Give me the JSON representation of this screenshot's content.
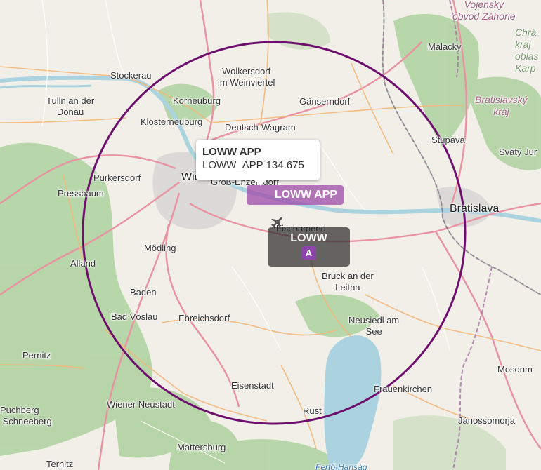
{
  "map": {
    "places": [
      {
        "id": "vojensky",
        "text": "Vojenský\nobvod Záhorie",
        "kind": "region"
      },
      {
        "id": "malacky",
        "text": "Malacky",
        "kind": "town"
      },
      {
        "id": "stockerau",
        "text": "Stockerau",
        "kind": "town"
      },
      {
        "id": "wolkersdorf",
        "text": "Wolkersdorf\nim Weinviertel",
        "kind": "town"
      },
      {
        "id": "tulln",
        "text": "Tulln an der\nDonau",
        "kind": "town"
      },
      {
        "id": "korneuburg",
        "text": "Korneuburg",
        "kind": "town"
      },
      {
        "id": "gaenserndorf",
        "text": "Gänserndorf",
        "kind": "town"
      },
      {
        "id": "klosterneuburg",
        "text": "Klosterneuburg",
        "kind": "town"
      },
      {
        "id": "deutsch_wagram",
        "text": "Deutsch-Wagram",
        "kind": "town"
      },
      {
        "id": "stupava",
        "text": "Stupava",
        "kind": "town"
      },
      {
        "id": "svaty_jur",
        "text": "Svätý Jur",
        "kind": "town"
      },
      {
        "id": "purkersdorf",
        "text": "Purkersdorf",
        "kind": "town"
      },
      {
        "id": "wien",
        "text": "Wien",
        "kind": "city"
      },
      {
        "id": "gross_enzersdorf",
        "text": "Groß-Enzersdorf",
        "kind": "town"
      },
      {
        "id": "pressbaum",
        "text": "Pressbaum",
        "kind": "town"
      },
      {
        "id": "bratislava",
        "text": "Bratislava",
        "kind": "city"
      },
      {
        "id": "fischamend",
        "text": "Fischamend",
        "kind": "town"
      },
      {
        "id": "moedling",
        "text": "Mödling",
        "kind": "town"
      },
      {
        "id": "alland",
        "text": "Alland",
        "kind": "town"
      },
      {
        "id": "bruck",
        "text": "Bruck an der\nLeitha",
        "kind": "town"
      },
      {
        "id": "baden",
        "text": "Baden",
        "kind": "town"
      },
      {
        "id": "bad_voeslau",
        "text": "Bad Vöslau",
        "kind": "town"
      },
      {
        "id": "ebreichsdorf",
        "text": "Ebreichsdorf",
        "kind": "town"
      },
      {
        "id": "neusiedl",
        "text": "Neusiedl am\nSee",
        "kind": "town"
      },
      {
        "id": "pernitz",
        "text": "Pernitz",
        "kind": "town"
      },
      {
        "id": "mosonm",
        "text": "Mosonm",
        "kind": "town"
      },
      {
        "id": "eisenstadt",
        "text": "Eisenstadt",
        "kind": "town"
      },
      {
        "id": "frauenkirchen",
        "text": "Frauenkirchen",
        "kind": "town"
      },
      {
        "id": "puchberg",
        "text": "Puchberg\nSchneeberg",
        "kind": "town"
      },
      {
        "id": "wiener_neustadt",
        "text": "Wiener Neustadt",
        "kind": "town"
      },
      {
        "id": "rust",
        "text": "Rust",
        "kind": "town"
      },
      {
        "id": "janossomorja",
        "text": "Jánossomorja",
        "kind": "town"
      },
      {
        "id": "mattersburg",
        "text": "Mattersburg",
        "kind": "town"
      },
      {
        "id": "ternitz",
        "text": "Ternitz",
        "kind": "town"
      },
      {
        "id": "ferto",
        "text": "Fertő-Hanság",
        "kind": "water"
      },
      {
        "id": "bratislavsky",
        "text": "Bratislavský\nkraj",
        "kind": "region"
      },
      {
        "id": "chrastava",
        "text": "Chrá\nkraj\noblas\nKarp",
        "kind": "region2"
      }
    ],
    "range_ring": {
      "color": "#6e0f6e",
      "label": ""
    },
    "colors": {
      "forest": "#add19e",
      "water": "#aad3df",
      "urban": "#e0dfdf",
      "motorway": "#e892a2",
      "primary": "#fcd6a4",
      "border": "#9e6b9e"
    }
  },
  "popup": {
    "title": "LOWW APP",
    "subtitle": "LOWW_APP 134.675"
  },
  "approach_badge": {
    "label": "LOWW APP"
  },
  "airport": {
    "code": "LOWW",
    "category": "A",
    "icon": "airplane-icon"
  }
}
